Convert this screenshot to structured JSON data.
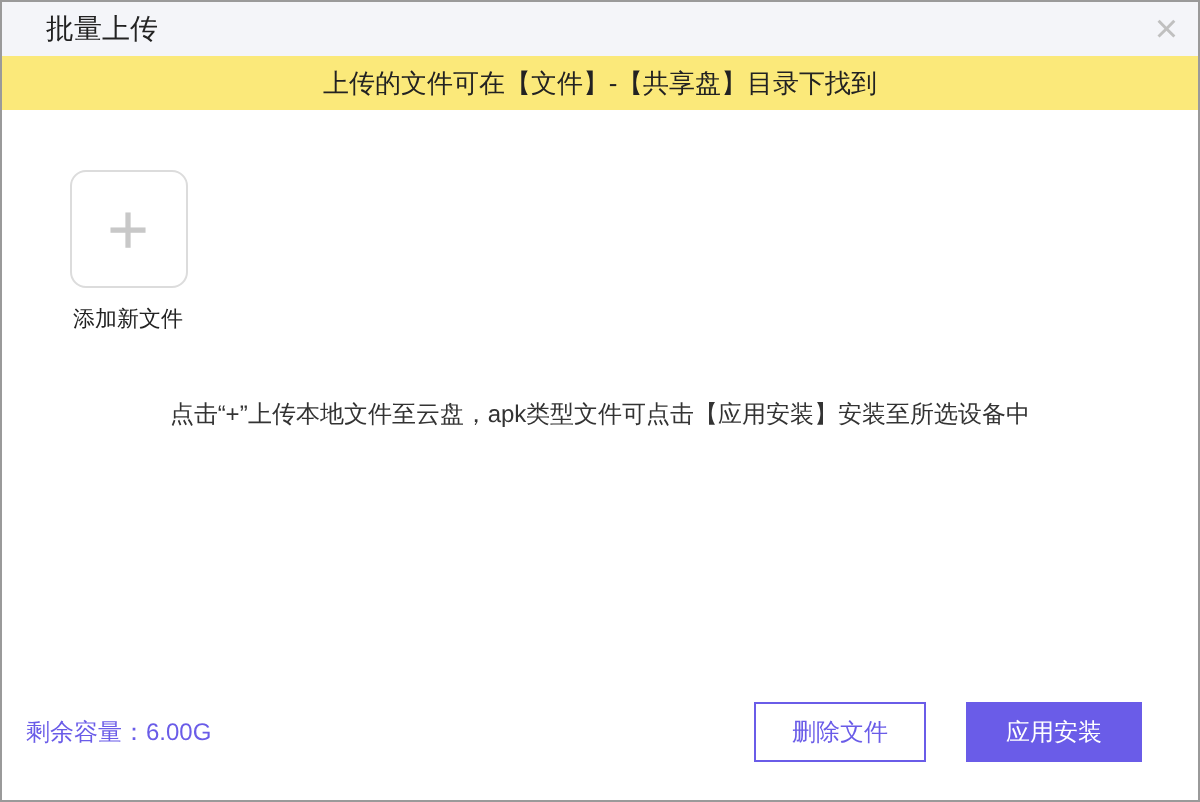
{
  "window": {
    "title": "批量上传",
    "close": "×"
  },
  "notice": "上传的文件可在【文件】-【共享盘】目录下找到",
  "add_tile": {
    "icon": "+",
    "label": "添加新文件"
  },
  "hint": "点击“+”上传本地文件至云盘，apk类型文件可点击【应用安装】安装至所选设备中",
  "capacity": "剩余容量：6.00G",
  "buttons": [
    {
      "label": "删除文件",
      "kind": "outline"
    },
    {
      "label": "应用安装",
      "kind": "primary"
    }
  ]
}
